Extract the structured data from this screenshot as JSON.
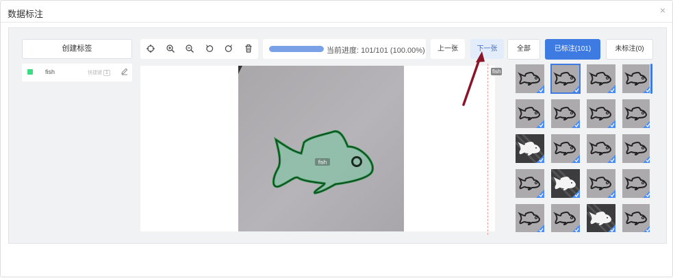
{
  "dialog": {
    "title": "数据标注",
    "close_glyph": "×"
  },
  "sidebar": {
    "create_label_button": "创建标签",
    "labels": [
      {
        "name": "fish",
        "hotkey_text": "快捷键",
        "hotkey": "1",
        "color": "#3ddc84"
      }
    ]
  },
  "toolbar": {
    "icons": [
      "crosshair-icon",
      "zoom-in-icon",
      "zoom-out-icon",
      "rotate-left-icon",
      "rotate-right-icon",
      "delete-icon"
    ]
  },
  "progress": {
    "text": "当前进度: 101/101 (100.00%)",
    "fraction": 1.0
  },
  "navigation": {
    "prev_label": "上一张",
    "next_label": "下一张"
  },
  "filters": {
    "all_label": "全部",
    "annotated_label": "已标注(101)",
    "unannotated_label": "未标注(0)"
  },
  "canvas": {
    "shape_label": "fish",
    "cut_label": "fish"
  },
  "colors": {
    "accent": "#3d7be3",
    "polygon_stroke": "#1d8a3c",
    "polygon_fill": "#8cbfa9",
    "check": "#4b8df8"
  },
  "thumbnails": [
    {
      "bg": "photo",
      "fish": "dark"
    },
    {
      "bg": "photo",
      "fish": "dark",
      "selected": true
    },
    {
      "bg": "photo",
      "fish": "dark"
    },
    {
      "bg": "photo",
      "fish": "dark"
    },
    {
      "bg": "photo",
      "fish": "dark"
    },
    {
      "bg": "photo",
      "fish": "dark"
    },
    {
      "bg": "photo",
      "fish": "dark"
    },
    {
      "bg": "photo",
      "fish": "dark"
    },
    {
      "bg": "dark",
      "fish": "white"
    },
    {
      "bg": "photo",
      "fish": "dark"
    },
    {
      "bg": "photo",
      "fish": "dark"
    },
    {
      "bg": "photo",
      "fish": "dark"
    },
    {
      "bg": "photo",
      "fish": "dark"
    },
    {
      "bg": "dark",
      "fish": "white"
    },
    {
      "bg": "photo",
      "fish": "dark"
    },
    {
      "bg": "photo",
      "fish": "dark"
    },
    {
      "bg": "photo",
      "fish": "dark"
    },
    {
      "bg": "photo",
      "fish": "dark"
    },
    {
      "bg": "dark",
      "fish": "white"
    },
    {
      "bg": "photo",
      "fish": "dark"
    }
  ]
}
